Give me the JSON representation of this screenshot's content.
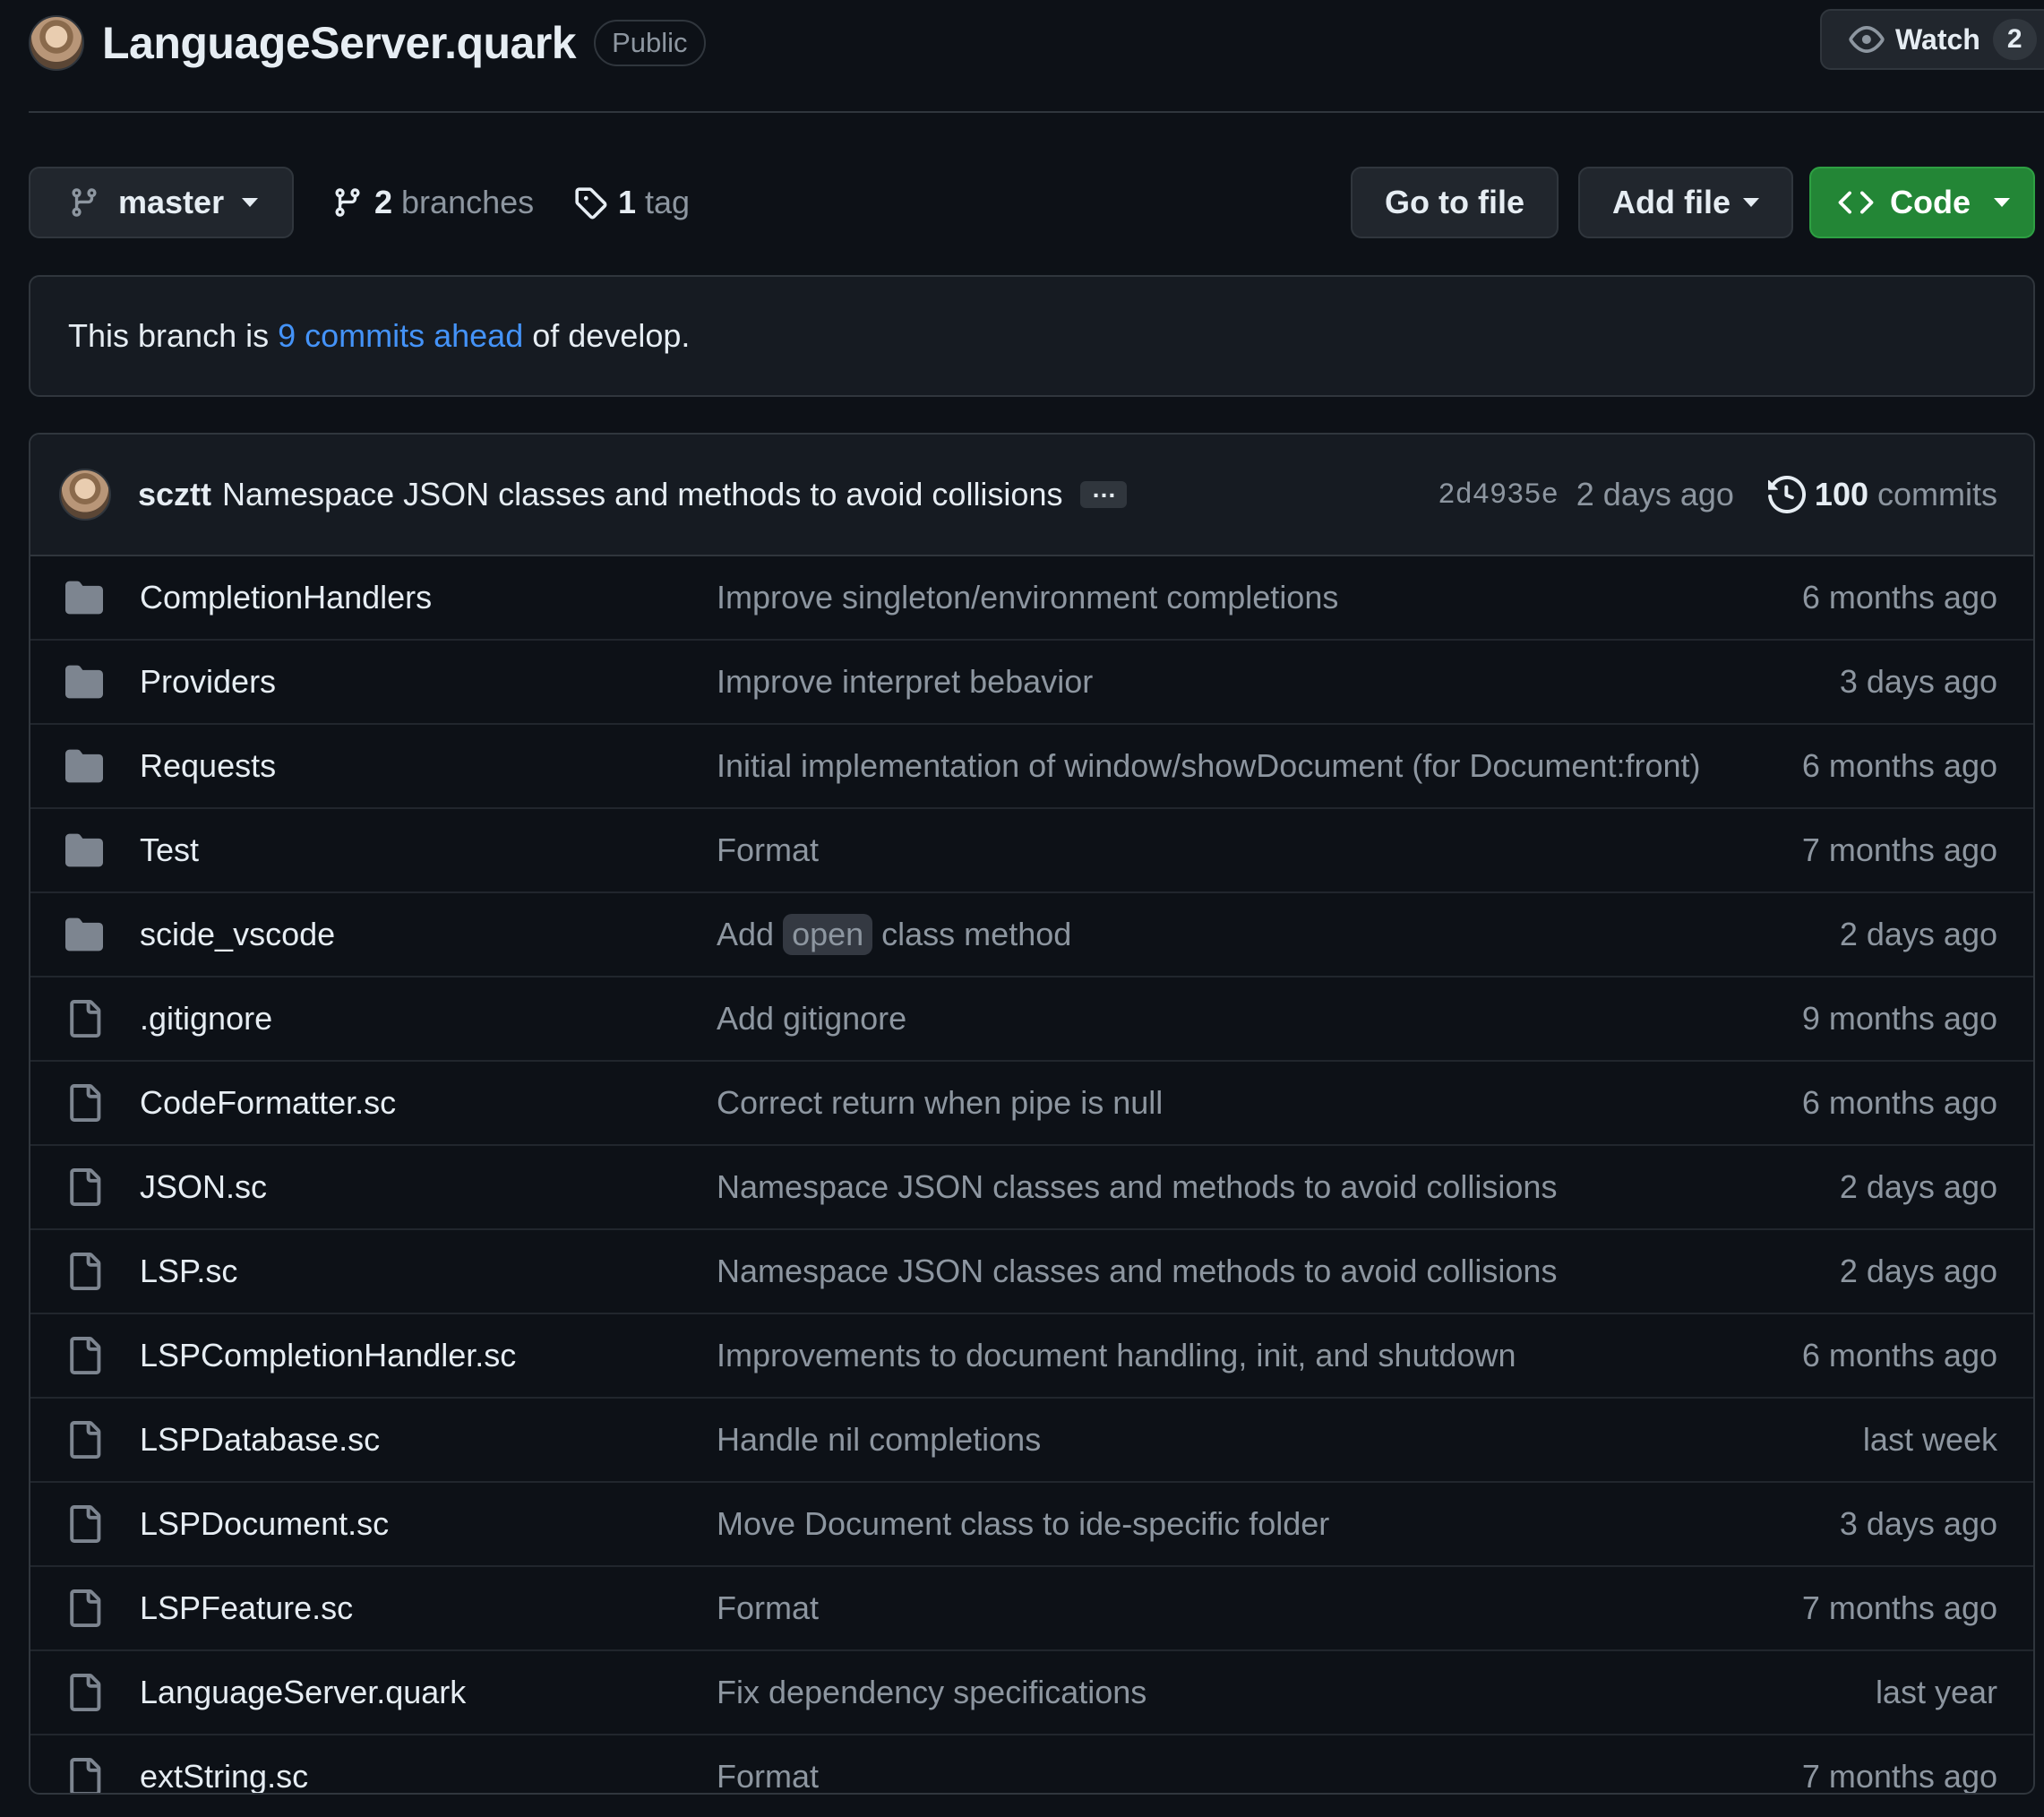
{
  "header": {
    "repo_name": "LanguageServer.quark",
    "visibility": "Public",
    "watch_label": "Watch",
    "watch_count": "2"
  },
  "toolbar": {
    "branch": "master",
    "branches_count": "2",
    "branches_label": "branches",
    "tags_count": "1",
    "tags_label": "tag",
    "goto_file": "Go to file",
    "add_file": "Add file",
    "code": "Code"
  },
  "ahead": {
    "prefix": "This branch is ",
    "link": "9 commits ahead",
    "suffix": " of develop."
  },
  "latest_commit": {
    "author": "scztt",
    "message": "Namespace JSON classes and methods to avoid collisions",
    "ellipsis": "…",
    "sha": "2d4935e",
    "date": "2 days ago",
    "count": "100",
    "count_label": "commits"
  },
  "files": [
    {
      "type": "dir",
      "name": "CompletionHandlers",
      "message": "Improve singleton/environment completions",
      "time": "6 months ago"
    },
    {
      "type": "dir",
      "name": "Providers",
      "message": "Improve interpret bebavior",
      "time": "3 days ago"
    },
    {
      "type": "dir",
      "name": "Requests",
      "message": "Initial implementation of window/showDocument (for Document:front)",
      "time": "6 months ago"
    },
    {
      "type": "dir",
      "name": "Test",
      "message": "Format",
      "time": "7 months ago"
    },
    {
      "type": "dir",
      "name": "scide_vscode",
      "message_pre": "Add",
      "message_code": "open",
      "message_post": "class method",
      "time": "2 days ago"
    },
    {
      "type": "file",
      "name": ".gitignore",
      "message": "Add gitignore",
      "time": "9 months ago"
    },
    {
      "type": "file",
      "name": "CodeFormatter.sc",
      "message": "Correct return when pipe is null",
      "time": "6 months ago"
    },
    {
      "type": "file",
      "name": "JSON.sc",
      "message": "Namespace JSON classes and methods to avoid collisions",
      "time": "2 days ago"
    },
    {
      "type": "file",
      "name": "LSP.sc",
      "message": "Namespace JSON classes and methods to avoid collisions",
      "time": "2 days ago"
    },
    {
      "type": "file",
      "name": "LSPCompletionHandler.sc",
      "message": "Improvements to document handling, init, and shutdown",
      "time": "6 months ago"
    },
    {
      "type": "file",
      "name": "LSPDatabase.sc",
      "message": "Handle nil completions",
      "time": "last week"
    },
    {
      "type": "file",
      "name": "LSPDocument.sc",
      "message": "Move Document class to ide-specific folder",
      "time": "3 days ago"
    },
    {
      "type": "file",
      "name": "LSPFeature.sc",
      "message": "Format",
      "time": "7 months ago"
    },
    {
      "type": "file",
      "name": "LanguageServer.quark",
      "message": "Fix dependency specifications",
      "time": "last year"
    },
    {
      "type": "file",
      "name": "extString.sc",
      "message": "Format",
      "time": "7 months ago"
    }
  ],
  "colors": {
    "background": "#0d1117",
    "accent_link": "#4493f8",
    "code_button": "#238636",
    "muted_text": "#8d96a0"
  }
}
